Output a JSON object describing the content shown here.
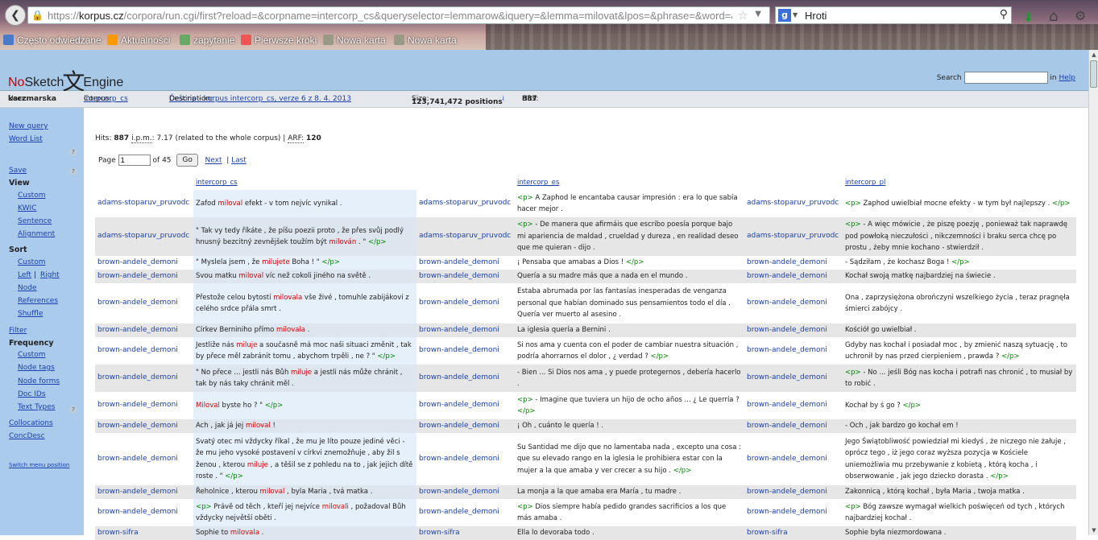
{
  "browser": {
    "url_prefix": "https://",
    "url_host": "korpus.cz",
    "url_rest": "/corpora/run.cgi/first?reload=&corpname=intercorp_cs&queryselector=lemmarow&iquery=&lemma=milovat&lpos=&phrase=&word=&w",
    "search_value": "Hroti",
    "bookmarks": [
      "Często odwiedzane",
      "Aktualności",
      "zapytanie",
      "Pierwsze kroki",
      "Nowa karta",
      "Nowa karta"
    ]
  },
  "header": {
    "logo_no": "No",
    "logo_sketch": "Sketch",
    "logo_glyph": "文",
    "logo_engine": "Engine",
    "search_label": "Search",
    "in_label": "in",
    "help_link": "Help"
  },
  "info": {
    "user_label": "User:",
    "user": "kaczmarska",
    "corpus_label": "Corpus:",
    "corpus": "intercorp_cs",
    "desc_label": "Description:",
    "desc": "Čeština - korpus intercorp_cs, verze 6 z 8. 4. 2013",
    "size_label": "Size:",
    "size": "123,741,472 positions",
    "size_sup": "i",
    "hits_label": "Hits:",
    "hits": "887"
  },
  "sidebar": {
    "new_query": "New query",
    "word_list": "Word List",
    "save": "Save",
    "view": "View",
    "view_items": [
      "Custom",
      "KWIC",
      "Sentence",
      "Alignment"
    ],
    "sort": "Sort",
    "sort_items": [
      "Custom",
      "Left",
      "|",
      "Right",
      "Node",
      "References",
      "Shuffle"
    ],
    "filter": "Filter",
    "frequency": "Frequency",
    "freq_items": [
      "Custom",
      "Node tags",
      "Node forms",
      "Doc IDs",
      "Text Types"
    ],
    "collocations": "Collocations",
    "concdesc": "ConcDesc",
    "switch": "Switch menu position",
    "qmark": "?"
  },
  "results": {
    "hits_prefix": "Hits:",
    "hits_value": "887",
    "ipm_label": "i.p.m.",
    "ipm_value": ": 7.17 (related to the whole corpus) |",
    "arf_label": "ARF:",
    "arf_value": "120",
    "page_label": "Page",
    "page_value": "1",
    "of_pages": "of 45",
    "go": "Go",
    "next": "Next",
    "last": "Last"
  },
  "columns": [
    "intercorp_cs",
    "intercorp_es",
    "intercorp_pl"
  ],
  "rows": [
    {
      "ref": "adams-stoparuv_pruvodc",
      "cs": [
        [
          "",
          "Zafod "
        ],
        [
          "k",
          "miloval"
        ],
        [
          "",
          "  efekt - v tom nejvíc vynikal ."
        ]
      ],
      "es": [
        [
          "t",
          "<p>"
        ],
        [
          "",
          " A Zaphod le encantaba causar impresión : era lo que sabía hacer mejor ."
        ]
      ],
      "pl": [
        [
          "t",
          "<p>"
        ],
        [
          "",
          " Zaphod uwielbiał mocne efekty - w tym był najlepszy . "
        ],
        [
          "t",
          "</p>"
        ]
      ]
    },
    {
      "ref": "adams-stoparuv_pruvodc",
      "cs": [
        [
          "",
          "\" Tak vy tedy říkáte , že píšu poezii proto , že přes svůj podlý hnusný bezcitný zevnějšek toužím být "
        ],
        [
          "k",
          "milován"
        ],
        [
          "",
          " . \" "
        ],
        [
          "t",
          "</p>"
        ]
      ],
      "es": [
        [
          "t",
          "<p>"
        ],
        [
          "",
          " - De manera que afirmáis que escribo poesía porque bajo mi apariencia de maldad , crueldad y dureza , en realidad deseo que me quieran - dijo ."
        ]
      ],
      "pl": [
        [
          "t",
          "<p>"
        ],
        [
          "",
          " - A więc mówicie , że piszę poezję , ponieważ tak naprawdę pod powłoką nieczułości , nikczemności i braku serca chcę po prostu , żeby mnie kochano - stwierdził ."
        ]
      ]
    },
    {
      "ref": "brown-andele_demoni",
      "cs": [
        [
          "",
          "\" Myslela jsem , že "
        ],
        [
          "k",
          "milujete"
        ],
        [
          "",
          " Boha ! \" "
        ],
        [
          "t",
          "</p>"
        ]
      ],
      "es": [
        [
          "",
          "¡ Pensaba que amabas a Dios ! "
        ],
        [
          "t",
          "</p>"
        ]
      ],
      "pl": [
        [
          "",
          "- Sądziłam , że kochasz Boga ! "
        ],
        [
          "t",
          "</p>"
        ]
      ]
    },
    {
      "ref": "brown-andele_demoni",
      "cs": [
        [
          "",
          "Svou matku "
        ],
        [
          "k",
          "miloval"
        ],
        [
          "",
          " víc než cokoli jiného na světě ."
        ]
      ],
      "es": [
        [
          "",
          "Quería a su madre más que a nada en el mundo ."
        ]
      ],
      "pl": [
        [
          "",
          "Kochał swoją matkę najbardziej na świecie ."
        ]
      ]
    },
    {
      "ref": "brown-andele_demoni",
      "cs": [
        [
          "",
          "Přestože celou bytostí "
        ],
        [
          "k",
          "milovala"
        ],
        [
          "",
          " vše živé , tomuhle zabijákovi z celého srdce přála smrt ."
        ]
      ],
      "es": [
        [
          "",
          "Estaba abrumada por las fantasías inesperadas de venganza personal que habían dominado sus pensamientos todo el día . Quería ver muerto al asesino ."
        ]
      ],
      "pl": [
        [
          "",
          "Ona , zaprzysiężona obrończyni wszelkiego życia , teraz pragnęła śmierci zabójcy ."
        ]
      ]
    },
    {
      "ref": "brown-andele_demoni",
      "cs": [
        [
          "",
          "Církev Berniniho přímo "
        ],
        [
          "k",
          "milovala"
        ],
        [
          "",
          " ."
        ]
      ],
      "es": [
        [
          "",
          "La iglesia quería a Bernini ."
        ]
      ],
      "pl": [
        [
          "",
          "Kościół go uwielbiał ."
        ]
      ]
    },
    {
      "ref": "brown-andele_demoni",
      "cs": [
        [
          "",
          "Jestliže nás "
        ],
        [
          "k",
          "miluje"
        ],
        [
          "",
          " a současně má moc naši situaci změnit , tak by přece měl zabránit tomu , abychom trpěli , ne ? \" "
        ],
        [
          "t",
          "</p>"
        ]
      ],
      "es": [
        [
          "",
          "Si nos ama y cuenta con el poder de cambiar nuestra situación , podría ahorrarnos el dolor , ¿ verdad ? "
        ],
        [
          "t",
          "</p>"
        ]
      ],
      "pl": [
        [
          "",
          "Gdyby nas kochał i posiadał moc , by zmienić naszą sytuację , to uchronił by nas przed cierpieniem , prawda ? "
        ],
        [
          "t",
          "</p>"
        ]
      ]
    },
    {
      "ref": "brown-andele_demoni",
      "cs": [
        [
          "",
          "\" No přece ... jestli nás Bůh "
        ],
        [
          "k",
          "miluje"
        ],
        [
          "",
          " a jestli nás může chránit , tak by nás taky chránit měl ."
        ]
      ],
      "es": [
        [
          "",
          "- Bien ... Si Dios nos ama , y puede protegernos , debería hacerlo ."
        ]
      ],
      "pl": [
        [
          "t",
          "<p>"
        ],
        [
          "",
          " - No ... jeśli Bóg nas kocha i potrafi nas chronić , to musiał by to robić ."
        ]
      ]
    },
    {
      "ref": "brown-andele_demoni",
      "cs": [
        [
          "k",
          "Miloval"
        ],
        [
          "",
          " byste ho ? \" "
        ],
        [
          "t",
          "</p>"
        ]
      ],
      "es": [
        [
          "t",
          "<p>"
        ],
        [
          "",
          " - Imagine que tuviera un hijo de ocho años ... ¿ Le querría ? "
        ],
        [
          "t",
          "</p>"
        ]
      ],
      "pl": [
        [
          "",
          "Kochał by ś go ? "
        ],
        [
          "t",
          "</p>"
        ]
      ]
    },
    {
      "ref": "brown-andele_demoni",
      "cs": [
        [
          "",
          "Ach , jak já jej "
        ],
        [
          "k",
          "miloval"
        ],
        [
          "",
          " !"
        ]
      ],
      "es": [
        [
          "",
          "¡ Oh , cuánto le quería ! ."
        ]
      ],
      "pl": [
        [
          "",
          "- Och , jak bardzo go kochał em !"
        ]
      ]
    },
    {
      "ref": "brown-andele_demoni",
      "cs": [
        [
          "",
          "Svatý otec mi vždycky říkal , že mu je líto pouze jediné věci - že mu jeho vysoké postavení v církvi znemožňuje , aby žil s ženou , kterou "
        ],
        [
          "k",
          "miluje"
        ],
        [
          "",
          " , a těšil se z pohledu na to , jak jejich dítě roste . \" "
        ],
        [
          "t",
          "</p>"
        ]
      ],
      "es": [
        [
          "",
          "Su Santidad me dijo que no lamentaba nada , excepto una cosa : que su elevado rango en la iglesia le prohibiera estar con la mujer a la que amaba y ver crecer a su hijo . "
        ],
        [
          "t",
          "</p>"
        ]
      ],
      "pl": [
        [
          "",
          "Jego Świątobliwość powiedział mi kiedyś , że niczego nie żałuje , oprócz tego , iż jego coraz wyższa pozycja w Kościele uniemożliwia mu przebywanie z kobietą , którą kocha , i obserwowanie , jak jego dziecko dorasta . "
        ],
        [
          "t",
          "</p>"
        ]
      ]
    },
    {
      "ref": "brown-andele_demoni",
      "cs": [
        [
          "",
          "Řeholnice , kterou "
        ],
        [
          "k",
          "miloval"
        ],
        [
          "",
          " , byla Maria , tvá matka ."
        ]
      ],
      "es": [
        [
          "",
          "La monja a la que amaba era María , tu madre ."
        ]
      ],
      "pl": [
        [
          "",
          "Zakonnicą , którą kochał , była Maria , twoja matka ."
        ]
      ]
    },
    {
      "ref": "brown-andele_demoni",
      "cs": [
        [
          "t",
          "<p>"
        ],
        [
          "",
          " Právě od těch , kteří jej nejvíce "
        ],
        [
          "k",
          "milovali"
        ],
        [
          "",
          " , požadoval Bůh vždycky největší oběti ."
        ]
      ],
      "es": [
        [
          "t",
          "<p>"
        ],
        [
          "",
          " Dios siempre había pedido grandes sacrificios a los que más amaba ."
        ]
      ],
      "pl": [
        [
          "t",
          "<p>"
        ],
        [
          "",
          " Bóg zawsze wymagał wielkich poświęceń od tych , których najbardziej kochał ."
        ]
      ]
    },
    {
      "ref": "brown-sifra",
      "cs": [
        [
          "",
          "Sophie to "
        ],
        [
          "k",
          "milovala"
        ],
        [
          "",
          " ."
        ]
      ],
      "es": [
        [
          "",
          "Ella lo devoraba todo ."
        ]
      ],
      "pl": [
        [
          "",
          "Sophie była niezmordowana ."
        ]
      ]
    }
  ]
}
